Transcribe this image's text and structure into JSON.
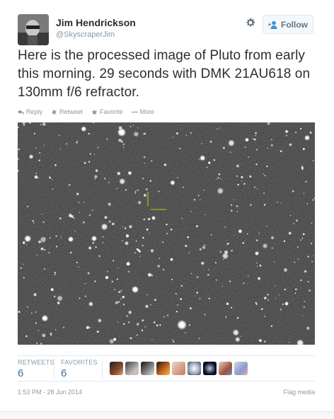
{
  "author": {
    "name": "Jim Hendrickson",
    "handle": "@SkyscraperJim"
  },
  "follow_label": "Follow",
  "tweet": {
    "text": "Here is the processed image of Pluto from early this morning. 29 seconds with DMK 21AU618 on 130mm f/6 refractor."
  },
  "actions": {
    "reply": "Reply",
    "retweet": "Retweet",
    "favorite": "Favorite",
    "more": "More"
  },
  "stats": {
    "retweets_label": "RETWEETS",
    "retweets_count": "6",
    "favorites_label": "FAVORITES",
    "favorites_count": "6"
  },
  "timestamp": "1:53 PM - 28 Jun 2014",
  "flag_label": "Flag media",
  "colors": {
    "link": "#3b6ea5",
    "muted": "#8899a6",
    "marker": "#c8d400"
  }
}
